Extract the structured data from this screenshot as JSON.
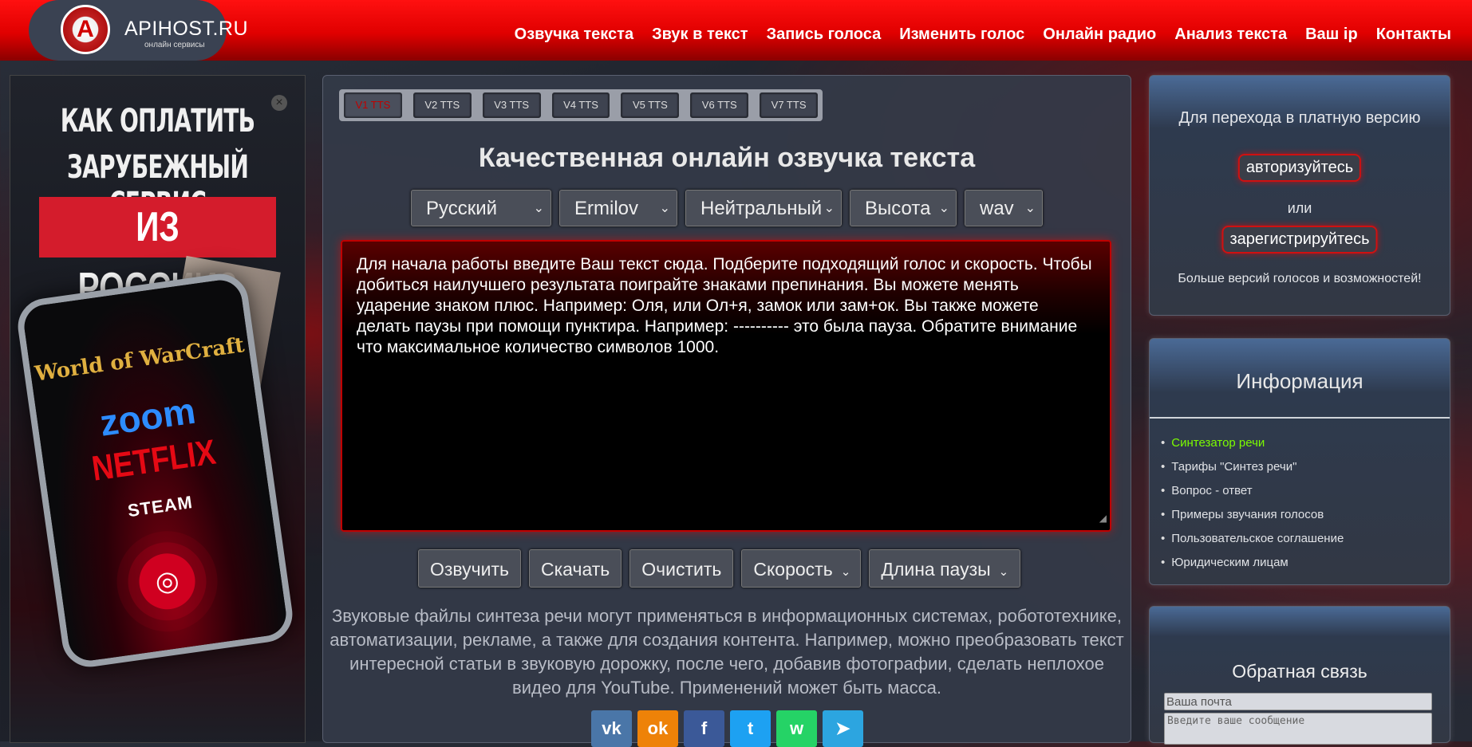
{
  "header": {
    "logo_letter": "A",
    "logo_text": "APIHOST.RU",
    "logo_sub": "онлайн сервисы",
    "nav": [
      "Озвучка текста",
      "Звук в текст",
      "Запись голоса",
      "Изменить голос",
      "Онлайн радио",
      "Анализ текста",
      "Ваш ip",
      "Контакты"
    ]
  },
  "ad": {
    "close": "×",
    "line1": "КАК ОПЛАТИТЬ",
    "line2": "ЗАРУБЕЖНЫЙ СЕРВИС",
    "line3": "ИЗ РОССИИ?",
    "brands": [
      "World of WarCraft",
      "zoom",
      "NETFLIX",
      "STEAM"
    ]
  },
  "main": {
    "tabs": [
      "V1 TTS",
      "V2 TTS",
      "V3 TTS",
      "V4 TTS",
      "V5 TTS",
      "V6 TTS",
      "V7 TTS"
    ],
    "active_tab": 0,
    "title": "Качественная онлайн озвучка текста",
    "selects": {
      "language": "Русский",
      "voice": "Ermilov",
      "emotion": "Нейтральный",
      "pitch": "Высота",
      "format": "wav"
    },
    "text": "Для начала работы введите Ваш текст сюда. Подберите подходящий голос и скорость. Чтобы добиться наилучшего результата поиграйте знаками препинания. Вы можете менять ударение знаком плюс. Например: Оля, или Ол+я, замок или зам+ок. Вы также можете делать паузы при помощи пунктира. Например: ---------- это была пауза. Обратите внимание что максимальное количество символов 1000.",
    "buttons": {
      "speak": "Озвучить",
      "download": "Скачать",
      "clear": "Очистить",
      "speed": "Скорость",
      "pause_length": "Длина паузы"
    },
    "description": "Звуковые файлы синтеза речи могут применяться в информационных системах, робототехнике, автоматизации, рекламе, а также для создания контента. Например, можно преобразовать текст интересной статьи в звуковую дорожку, после чего, добавив фотографии, сделать неплохое видео для YouTube. Применений может быть масса.",
    "share": [
      {
        "name": "vk",
        "label": "vk",
        "color": "#4a76a8"
      },
      {
        "name": "ok",
        "label": "ok",
        "color": "#ee8208"
      },
      {
        "name": "facebook",
        "label": "f",
        "color": "#3b5998"
      },
      {
        "name": "twitter",
        "label": "t",
        "color": "#1da1f2"
      },
      {
        "name": "whatsapp",
        "label": "w",
        "color": "#25d366"
      },
      {
        "name": "telegram",
        "label": "➤",
        "color": "#2ca5e0"
      }
    ]
  },
  "paid": {
    "text": "Для перехода в платную версию",
    "login": "авторизуйтесь",
    "or": "или",
    "register": "зарегистрируйтесь",
    "more": "Больше версий голосов и возможностей!"
  },
  "info": {
    "title": "Информация",
    "items": [
      "Синтезатор речи",
      "Тарифы \"Синтез речи\"",
      "Вопрос - ответ",
      "Примеры звучания голосов",
      "Пользовательское соглашение",
      "Юридическим лицам"
    ],
    "active_item": 0
  },
  "feedback": {
    "title": "Обратная связь",
    "email_placeholder": "Ваша почта",
    "message_placeholder": "Введите ваше сообщение"
  },
  "colors": {
    "brand_red": "#e00000",
    "active_link": "#7cfc00"
  }
}
